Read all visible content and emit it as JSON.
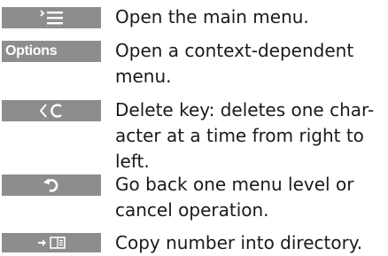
{
  "keys": [
    {
      "icon": "menu-icon",
      "label": "",
      "description": "Open the main menu."
    },
    {
      "icon": "",
      "label": "Options",
      "description": "Open a context-dependent\nmenu."
    },
    {
      "icon": "delete-icon",
      "label": "",
      "description": "Delete key: deletes one char-\nacter at a time from right to\nleft."
    },
    {
      "icon": "back-icon",
      "label": "",
      "description": "Go back one menu level or\ncancel operation."
    },
    {
      "icon": "copy-to-directory-icon",
      "label": "",
      "description": "Copy number into directory."
    }
  ]
}
